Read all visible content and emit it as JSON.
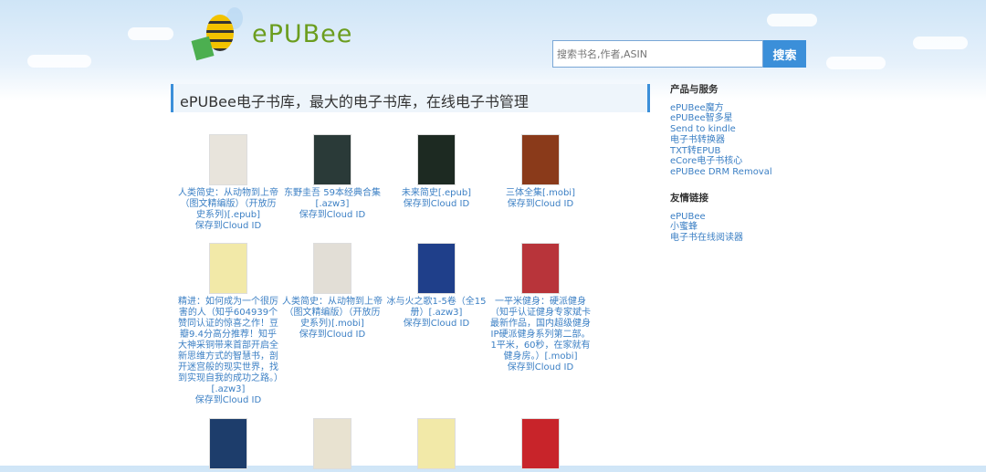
{
  "logo": {
    "text": "ePUBee"
  },
  "search": {
    "placeholder": "搜索书名,作者,ASIN",
    "button": "搜索"
  },
  "page_title": "ePUBee电子书库，最大的电子书库，在线电子书管理",
  "save_label": "保存到Cloud ID",
  "books": [
    {
      "title": "人类简史：从动物到上帝（图文精编版）（开放历史系列)[.epub]",
      "cover": "#e8e4dc"
    },
    {
      "title": "东野圭吾 59本经典合集[.azw3]",
      "cover": "#2a3a38"
    },
    {
      "title": "未来简史[.epub]",
      "cover": "#1d2a22"
    },
    {
      "title": "三体全集[.mobi]",
      "cover": "#8a3a1a"
    },
    {
      "title": "精进：如何成为一个很厉害的人（知乎604939个赞同认证的惊喜之作！豆瓣9.4分高分推荐！知乎大神采铜带来首部开启全新思维方式的智慧书，剖开迷宫般的现实世界，找到实现自我的成功之路。）[.azw3]",
      "cover": "#f2e9a8"
    },
    {
      "title": "人类简史：从动物到上帝（图文精编版）（开放历史系列)[.mobi]",
      "cover": "#e2ded6"
    },
    {
      "title": "冰与火之歌1-5卷（全15册）[.azw3]",
      "cover": "#1f3f8a"
    },
    {
      "title": "一平米健身：硬派健身（知乎认证健身专家斌卡最新作品，国内超级健身IP硬派健身系列第二部。1平米，60秒，在家就有健身房。）[.mobi]",
      "cover": "#b8343a"
    }
  ],
  "row3_covers": [
    "#1d3d6b",
    "#e8e2d0",
    "#f2e9a8",
    "#c8242a"
  ],
  "sidebar": {
    "products_heading": "产品与服务",
    "products": [
      "ePUBee魔方",
      "ePUBee智多星",
      "Send to kindle",
      "电子书转换器",
      "TXT转EPUB",
      "eCore电子书核心",
      "ePUBee DRM Removal"
    ],
    "links_heading": "友情链接",
    "links": [
      "ePUBee",
      "小蜜蜂",
      "电子书在线阅读器"
    ]
  }
}
